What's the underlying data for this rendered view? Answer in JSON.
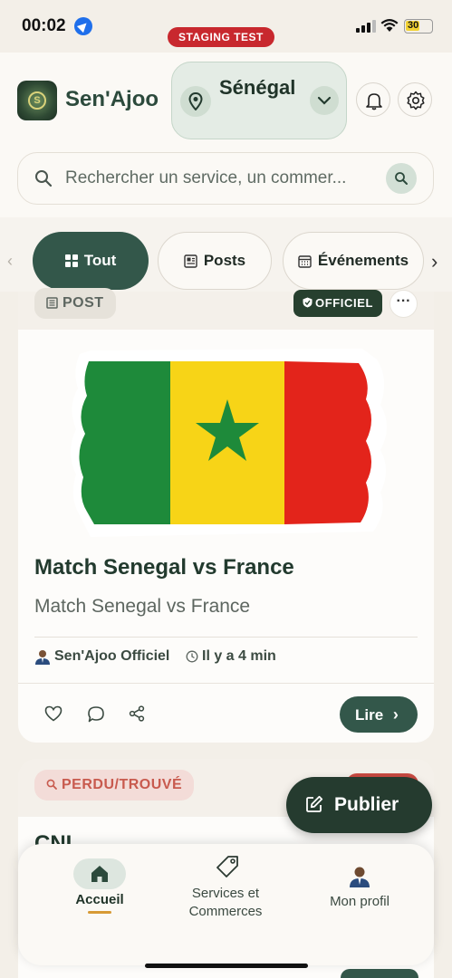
{
  "status_bar": {
    "time": "00:02",
    "staging_label": "STAGING TEST",
    "battery": "30"
  },
  "header": {
    "app_name": "Sen'Ajoo",
    "country": "Sénégal",
    "search_placeholder": "Rechercher un service, un commer..."
  },
  "tabs": {
    "all": "Tout",
    "posts": "Posts",
    "events": "Événements"
  },
  "post": {
    "type_badge": "POST",
    "official_badge": "OFFICIEL",
    "title": "Match Senegal vs France",
    "subtitle": "Match Senegal vs France",
    "author": "Sen'Ajoo Officiel",
    "time": "Il y a 4 min",
    "read_label": "Lire",
    "flag_colors": [
      "#1e8a3a",
      "#f7d417",
      "#e3241b"
    ]
  },
  "second_card": {
    "type_badge": "PERDU/TROUVÉ",
    "title": "CNI"
  },
  "fab": {
    "publish_label": "Publier"
  },
  "bottom_nav": {
    "home": "Accueil",
    "services": "Services et Commerces",
    "profile": "Mon profil"
  },
  "icons": {
    "location": "pin-icon",
    "dropdown": "chevron-down-icon",
    "notifications": "bell-icon",
    "settings": "gear-icon",
    "search": "search-icon",
    "like": "heart-icon",
    "comment": "comment-icon",
    "share": "share-icon",
    "publish": "edit-icon",
    "home": "home-icon",
    "services": "tag-icon"
  },
  "colors": {
    "primary": "#33574a",
    "dark": "#253b2f",
    "staging": "#c8282e",
    "lost_text": "#c85a4e"
  }
}
